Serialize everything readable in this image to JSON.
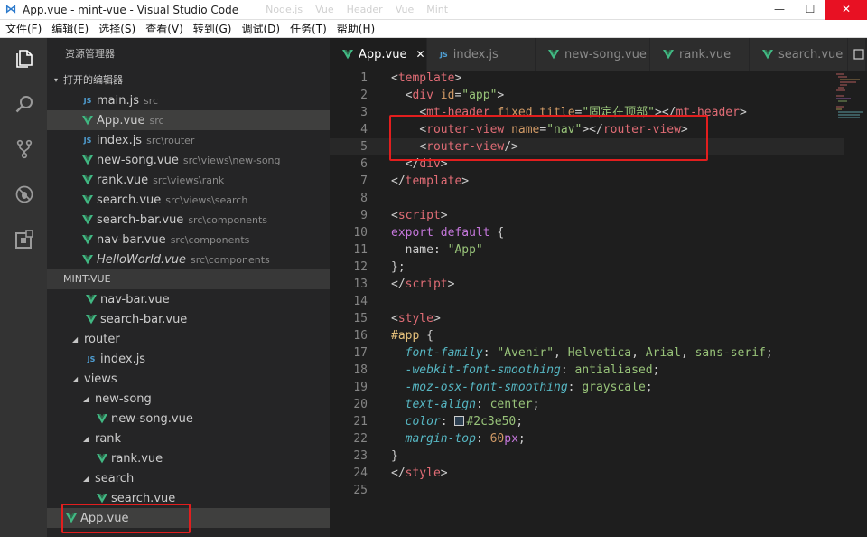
{
  "window": {
    "title": "App.vue - mint-vue - Visual Studio Code",
    "faded_tabs": [
      "Node.js",
      "Vue",
      "Header",
      "Vue",
      "Mint"
    ],
    "controls": {
      "minimize": "—",
      "maximize": "☐",
      "close": "✕"
    }
  },
  "menu": [
    "文件(F)",
    "编辑(E)",
    "选择(S)",
    "查看(V)",
    "转到(G)",
    "调试(D)",
    "任务(T)",
    "帮助(H)"
  ],
  "activity_bar": [
    "explorer-icon",
    "search-icon",
    "source-control-icon",
    "debug-icon",
    "extensions-icon"
  ],
  "sidebar": {
    "title": "资源管理器",
    "open_editors_header": "打开的编辑器",
    "open_editors": [
      {
        "type": "js",
        "name": "main.js",
        "path": "src"
      },
      {
        "type": "vue",
        "name": "App.vue",
        "path": "src",
        "active": true
      },
      {
        "type": "js",
        "name": "index.js",
        "path": "src\\router"
      },
      {
        "type": "vue",
        "name": "new-song.vue",
        "path": "src\\views\\new-song"
      },
      {
        "type": "vue",
        "name": "rank.vue",
        "path": "src\\views\\rank"
      },
      {
        "type": "vue",
        "name": "search.vue",
        "path": "src\\views\\search"
      },
      {
        "type": "vue",
        "name": "search-bar.vue",
        "path": "src\\components"
      },
      {
        "type": "vue",
        "name": "nav-bar.vue",
        "path": "src\\components"
      },
      {
        "type": "vue",
        "name": "HelloWorld.vue",
        "path": "src\\components",
        "italic": true
      }
    ],
    "project_header": "MINT-VUE",
    "tree": [
      {
        "type": "vue",
        "name": "nav-bar.vue",
        "depth": 2
      },
      {
        "type": "vue",
        "name": "search-bar.vue",
        "depth": 2
      },
      {
        "type": "folder",
        "name": "router",
        "depth": 1
      },
      {
        "type": "js",
        "name": "index.js",
        "depth": 2
      },
      {
        "type": "folder",
        "name": "views",
        "depth": 1
      },
      {
        "type": "folder",
        "name": "new-song",
        "depth": 2
      },
      {
        "type": "vue",
        "name": "new-song.vue",
        "depth": 3
      },
      {
        "type": "folder",
        "name": "rank",
        "depth": 2
      },
      {
        "type": "vue",
        "name": "rank.vue",
        "depth": 3
      },
      {
        "type": "folder",
        "name": "search",
        "depth": 2
      },
      {
        "type": "vue",
        "name": "search.vue",
        "depth": 3
      },
      {
        "type": "vue",
        "name": "App.vue",
        "depth": 1,
        "active": true
      }
    ]
  },
  "tabs": [
    {
      "type": "vue",
      "label": "App.vue",
      "active": true
    },
    {
      "type": "js",
      "label": "index.js"
    },
    {
      "type": "vue",
      "label": "new-song.vue"
    },
    {
      "type": "vue",
      "label": "rank.vue"
    },
    {
      "type": "vue",
      "label": "search.vue"
    }
  ],
  "code_lines": [
    [
      [
        "br",
        "<"
      ],
      [
        "tag",
        "template"
      ],
      [
        "br",
        ">"
      ]
    ],
    [
      [
        "pl",
        "  "
      ],
      [
        "br",
        "<"
      ],
      [
        "tag",
        "div"
      ],
      [
        "pl",
        " "
      ],
      [
        "at",
        "id"
      ],
      [
        "pl",
        "="
      ],
      [
        "st",
        "\"app\""
      ],
      [
        "br",
        ">"
      ]
    ],
    [
      [
        "pl",
        "    "
      ],
      [
        "br",
        "<"
      ],
      [
        "tag",
        "mt-header"
      ],
      [
        "pl",
        " "
      ],
      [
        "at",
        "fixed"
      ],
      [
        "pl",
        " "
      ],
      [
        "at",
        "title"
      ],
      [
        "pl",
        "="
      ],
      [
        "st",
        "\"固定在顶部\""
      ],
      [
        "br",
        "></"
      ],
      [
        "tag",
        "mt-header"
      ],
      [
        "br",
        ">"
      ]
    ],
    [
      [
        "pl",
        "    "
      ],
      [
        "br",
        "<"
      ],
      [
        "tag",
        "router-view"
      ],
      [
        "pl",
        " "
      ],
      [
        "at",
        "name"
      ],
      [
        "pl",
        "="
      ],
      [
        "st",
        "\"nav\""
      ],
      [
        "br",
        "></"
      ],
      [
        "tag",
        "router-view"
      ],
      [
        "br",
        ">"
      ]
    ],
    [
      [
        "pl",
        "    "
      ],
      [
        "br",
        "<"
      ],
      [
        "tag",
        "router-view"
      ],
      [
        "br",
        "/>"
      ]
    ],
    [
      [
        "pl",
        "  "
      ],
      [
        "br",
        "</"
      ],
      [
        "tag",
        "div"
      ],
      [
        "br",
        ">"
      ]
    ],
    [
      [
        "br",
        "</"
      ],
      [
        "tag",
        "template"
      ],
      [
        "br",
        ">"
      ]
    ],
    [],
    [
      [
        "br",
        "<"
      ],
      [
        "tag",
        "script"
      ],
      [
        "br",
        ">"
      ]
    ],
    [
      [
        "kw",
        "export"
      ],
      [
        "pl",
        " "
      ],
      [
        "kw",
        "default"
      ],
      [
        "pl",
        " {"
      ]
    ],
    [
      [
        "pl",
        "  name: "
      ],
      [
        "st",
        "\"App\""
      ]
    ],
    [
      [
        "pl",
        "};"
      ]
    ],
    [
      [
        "br",
        "</"
      ],
      [
        "tag",
        "script"
      ],
      [
        "br",
        ">"
      ]
    ],
    [],
    [
      [
        "br",
        "<"
      ],
      [
        "tag",
        "style"
      ],
      [
        "br",
        ">"
      ]
    ],
    [
      [
        "id",
        "#app"
      ],
      [
        "pl",
        " {"
      ]
    ],
    [
      [
        "pl",
        "  "
      ],
      [
        "pr",
        "font-family"
      ],
      [
        "pl",
        ": "
      ],
      [
        "st",
        "\"Avenir\""
      ],
      [
        "pl",
        ", "
      ],
      [
        "st",
        "Helvetica"
      ],
      [
        "pl",
        ", "
      ],
      [
        "st",
        "Arial"
      ],
      [
        "pl",
        ", "
      ],
      [
        "st",
        "sans-serif"
      ],
      [
        "pl",
        ";"
      ]
    ],
    [
      [
        "pl",
        "  "
      ],
      [
        "pr",
        "-webkit-font-smoothing"
      ],
      [
        "pl",
        ": "
      ],
      [
        "st",
        "antialiased"
      ],
      [
        "pl",
        ";"
      ]
    ],
    [
      [
        "pl",
        "  "
      ],
      [
        "pr",
        "-moz-osx-font-smoothing"
      ],
      [
        "pl",
        ": "
      ],
      [
        "st",
        "grayscale"
      ],
      [
        "pl",
        ";"
      ]
    ],
    [
      [
        "pl",
        "  "
      ],
      [
        "pr",
        "text-align"
      ],
      [
        "pl",
        ": "
      ],
      [
        "st",
        "center"
      ],
      [
        "pl",
        ";"
      ]
    ],
    [
      [
        "pl",
        "  "
      ],
      [
        "pr",
        "color"
      ],
      [
        "pl",
        ": "
      ],
      [
        "sw",
        ""
      ],
      [
        "st",
        "#2c3e50"
      ],
      [
        "pl",
        ";"
      ]
    ],
    [
      [
        "pl",
        "  "
      ],
      [
        "pr",
        "margin-top"
      ],
      [
        "pl",
        ": "
      ],
      [
        "nm",
        "60"
      ],
      [
        "un",
        "px"
      ],
      [
        "pl",
        ";"
      ]
    ],
    [
      [
        "pl",
        "}"
      ]
    ],
    [
      [
        "br",
        "</"
      ],
      [
        "tag",
        "style"
      ],
      [
        "br",
        ">"
      ]
    ],
    []
  ],
  "current_line": 5,
  "colors": {
    "accent": "#2c7acc",
    "vue_green": "#41b883",
    "annotation_red": "#e21e1e"
  }
}
